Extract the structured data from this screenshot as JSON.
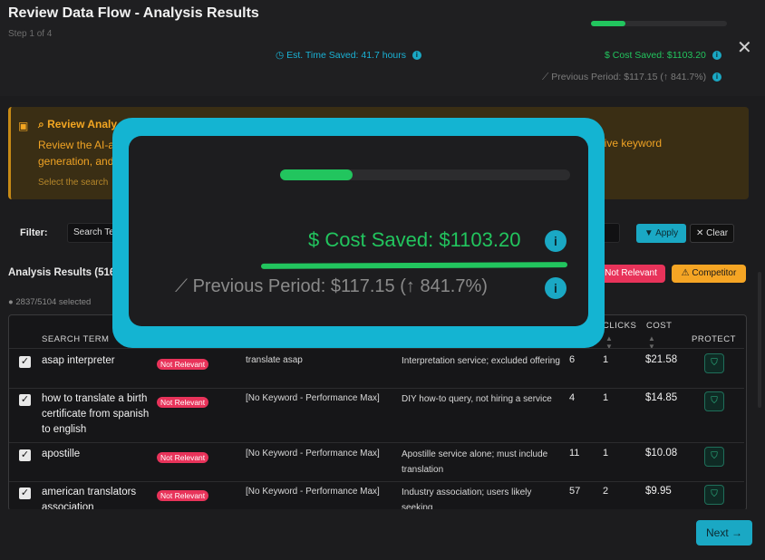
{
  "header": {
    "title": "Review Data Flow - Analysis Results",
    "step": "Step 1 of 4",
    "progress": 0.25,
    "time_saved": "Est. Time Saved: 41.7 hours",
    "cost_saved": "Cost Saved: $1103.20",
    "previous_period": "Previous Period: $117.15 (↑ 841.7%)",
    "close_icon": "close-icon"
  },
  "alert": {
    "title": "Review Analy",
    "body": "Review the AI-a",
    "body_2": "generation, and",
    "body_right": "gative keyword",
    "note": "Select the search"
  },
  "filter": {
    "label": "Filter:",
    "placeholder": "Search Te",
    "apply_label": "Apply",
    "clear_label": "Clear"
  },
  "results": {
    "title": "Analysis Results (516",
    "selected": "2837/5104 selected",
    "not_relevant_label": "Not Relevant",
    "competitor_label": "Competitor"
  },
  "table": {
    "headers": {
      "search_term": "SEARCH TERM",
      "clicks": "CLICKS",
      "cost": "COST",
      "protect": "PROTECT"
    },
    "rows": [
      {
        "term": "asap interpreter",
        "badge": "Not Relevant",
        "keyword": "translate asap",
        "reason": "Interpretation service; excluded offering",
        "impr": "6",
        "clicks": "1",
        "cost": "$21.58"
      },
      {
        "term": "how to translate a birth certificate from spanish to english",
        "badge": "Not Relevant",
        "keyword": "[No Keyword - Performance Max]",
        "reason": "DIY how-to query, not hiring a service",
        "impr": "4",
        "clicks": "1",
        "cost": "$14.85"
      },
      {
        "term": "apostille",
        "badge": "Not Relevant",
        "keyword": "[No Keyword - Performance Max]",
        "reason": "Apostille service alone; must include translation",
        "impr": "11",
        "clicks": "1",
        "cost": "$10.08"
      },
      {
        "term": "american translators association",
        "badge": "Not Relevant",
        "keyword": "[No Keyword - Performance Max]",
        "reason": "Industry association; users likely seeking",
        "impr": "57",
        "clicks": "2",
        "cost": "$9.95"
      }
    ]
  },
  "footer": {
    "next_label": "Next"
  },
  "zoom": {
    "cost_saved": "Cost Saved: $1103.20",
    "previous_period": "Previous Period: $117.15 (↑ 841.7%)"
  },
  "colors": {
    "accent": "#1aa8c4",
    "success": "#22c55e",
    "danger": "#e8335a",
    "warning": "#f5a524"
  }
}
